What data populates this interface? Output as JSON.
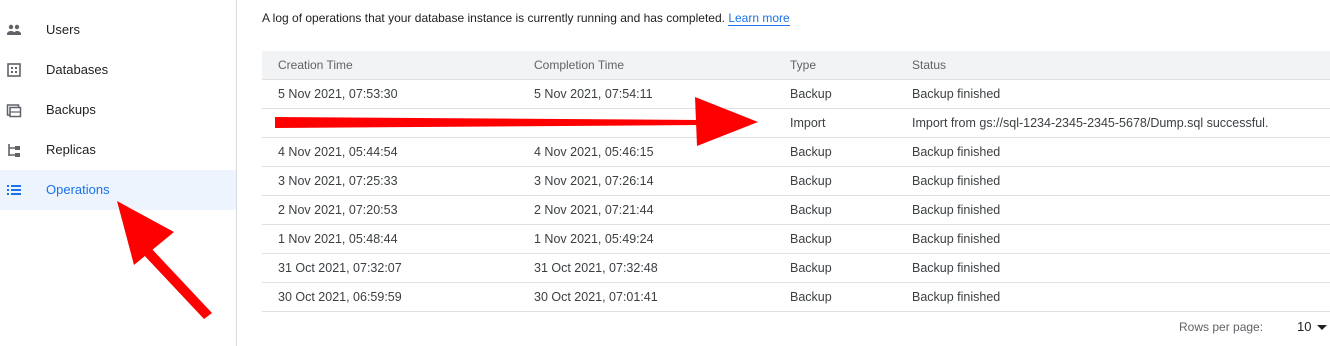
{
  "sidebar": {
    "items": [
      {
        "label": "Users",
        "icon": "users-icon"
      },
      {
        "label": "Databases",
        "icon": "databases-icon"
      },
      {
        "label": "Backups",
        "icon": "backups-icon"
      },
      {
        "label": "Replicas",
        "icon": "replicas-icon"
      },
      {
        "label": "Operations",
        "icon": "operations-icon",
        "active": true
      }
    ]
  },
  "main": {
    "description": "A log of operations that your database instance is currently running and has completed.",
    "learn_more": "Learn more",
    "table": {
      "headers": [
        "Creation Time",
        "Completion Time",
        "Type",
        "Status"
      ],
      "rows": [
        [
          "5 Nov 2021, 07:53:30",
          "5 Nov 2021, 07:54:11",
          "Backup",
          "Backup finished"
        ],
        [
          "",
          "",
          "Import",
          "Import from gs://sql-1234-2345-2345-5678/Dump.sql successful."
        ],
        [
          "4 Nov 2021, 05:44:54",
          "4 Nov 2021, 05:46:15",
          "Backup",
          "Backup finished"
        ],
        [
          "3 Nov 2021, 07:25:33",
          "3 Nov 2021, 07:26:14",
          "Backup",
          "Backup finished"
        ],
        [
          "2 Nov 2021, 07:20:53",
          "2 Nov 2021, 07:21:44",
          "Backup",
          "Backup finished"
        ],
        [
          "1 Nov 2021, 05:48:44",
          "1 Nov 2021, 05:49:24",
          "Backup",
          "Backup finished"
        ],
        [
          "31 Oct 2021, 07:32:07",
          "31 Oct 2021, 07:32:48",
          "Backup",
          "Backup finished"
        ],
        [
          "30 Oct 2021, 06:59:59",
          "30 Oct 2021, 07:01:41",
          "Backup",
          "Backup finished"
        ]
      ]
    },
    "pagination": {
      "rows_per_page_label": "Rows per page:",
      "rows_per_page_value": "10"
    }
  },
  "colors": {
    "accent": "#1a73e8",
    "active_bg": "#eef4fd",
    "annotation_red": "#ff0000"
  }
}
